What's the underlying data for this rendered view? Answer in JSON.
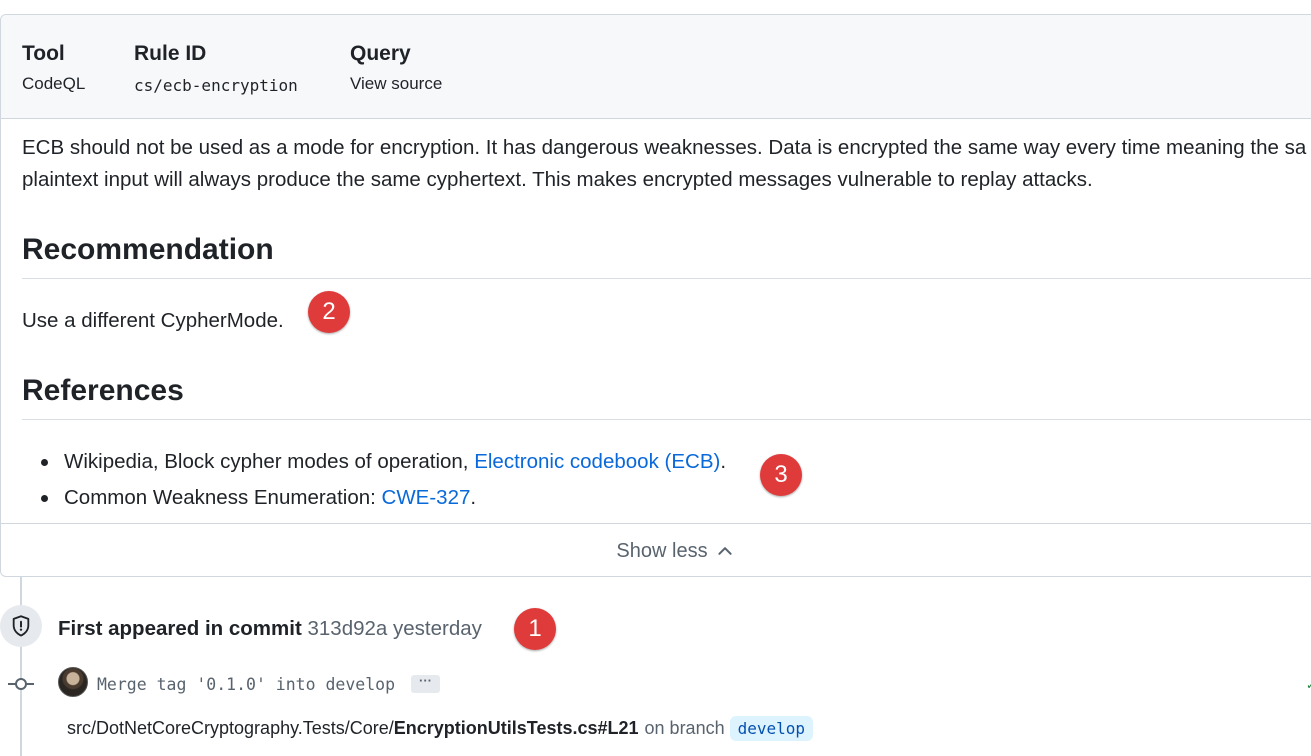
{
  "meta": {
    "tool_label": "Tool",
    "tool_value": "CodeQL",
    "rule_label": "Rule ID",
    "rule_value": "cs/ecb-encryption",
    "query_label": "Query",
    "query_value": "View source"
  },
  "description": {
    "line1": "ECB should not be used as a mode for encryption. It has dangerous weaknesses. Data is encrypted the same way every time meaning the sa",
    "line2": "plaintext input will always produce the same cyphertext. This makes encrypted messages vulnerable to replay attacks."
  },
  "recommendation": {
    "heading": "Recommendation",
    "text": "Use a different CypherMode."
  },
  "references": {
    "heading": "References",
    "items": [
      {
        "prefix": "Wikipedia, Block cypher modes of operation, ",
        "link": "Electronic codebook (ECB)",
        "suffix": "."
      },
      {
        "prefix": "Common Weakness Enumeration: ",
        "link": "CWE-327",
        "suffix": "."
      }
    ]
  },
  "show_less_label": "Show less",
  "annotations": [
    "1",
    "2",
    "3"
  ],
  "timeline": {
    "first_appeared_bold": "First appeared in commit",
    "commit_sha": "313d92a",
    "when": "yesterday",
    "commit_message": "Merge tag '0.1.0' into develop",
    "ellipsis": "···",
    "path_prefix": "src/DotNetCoreCryptography.Tests/Core/",
    "path_file": "EncryptionUtilsTests.cs#L21",
    "on_branch": "on branch",
    "branch": "develop"
  },
  "colors": {
    "link": "#0969da",
    "badge_red": "#e03b3b",
    "branch_pill_bg": "#ddf4ff",
    "branch_pill_text": "#0550ae"
  },
  "icons": [
    "shield-icon",
    "chevron-up-icon",
    "commit-node-icon",
    "avatar"
  ]
}
